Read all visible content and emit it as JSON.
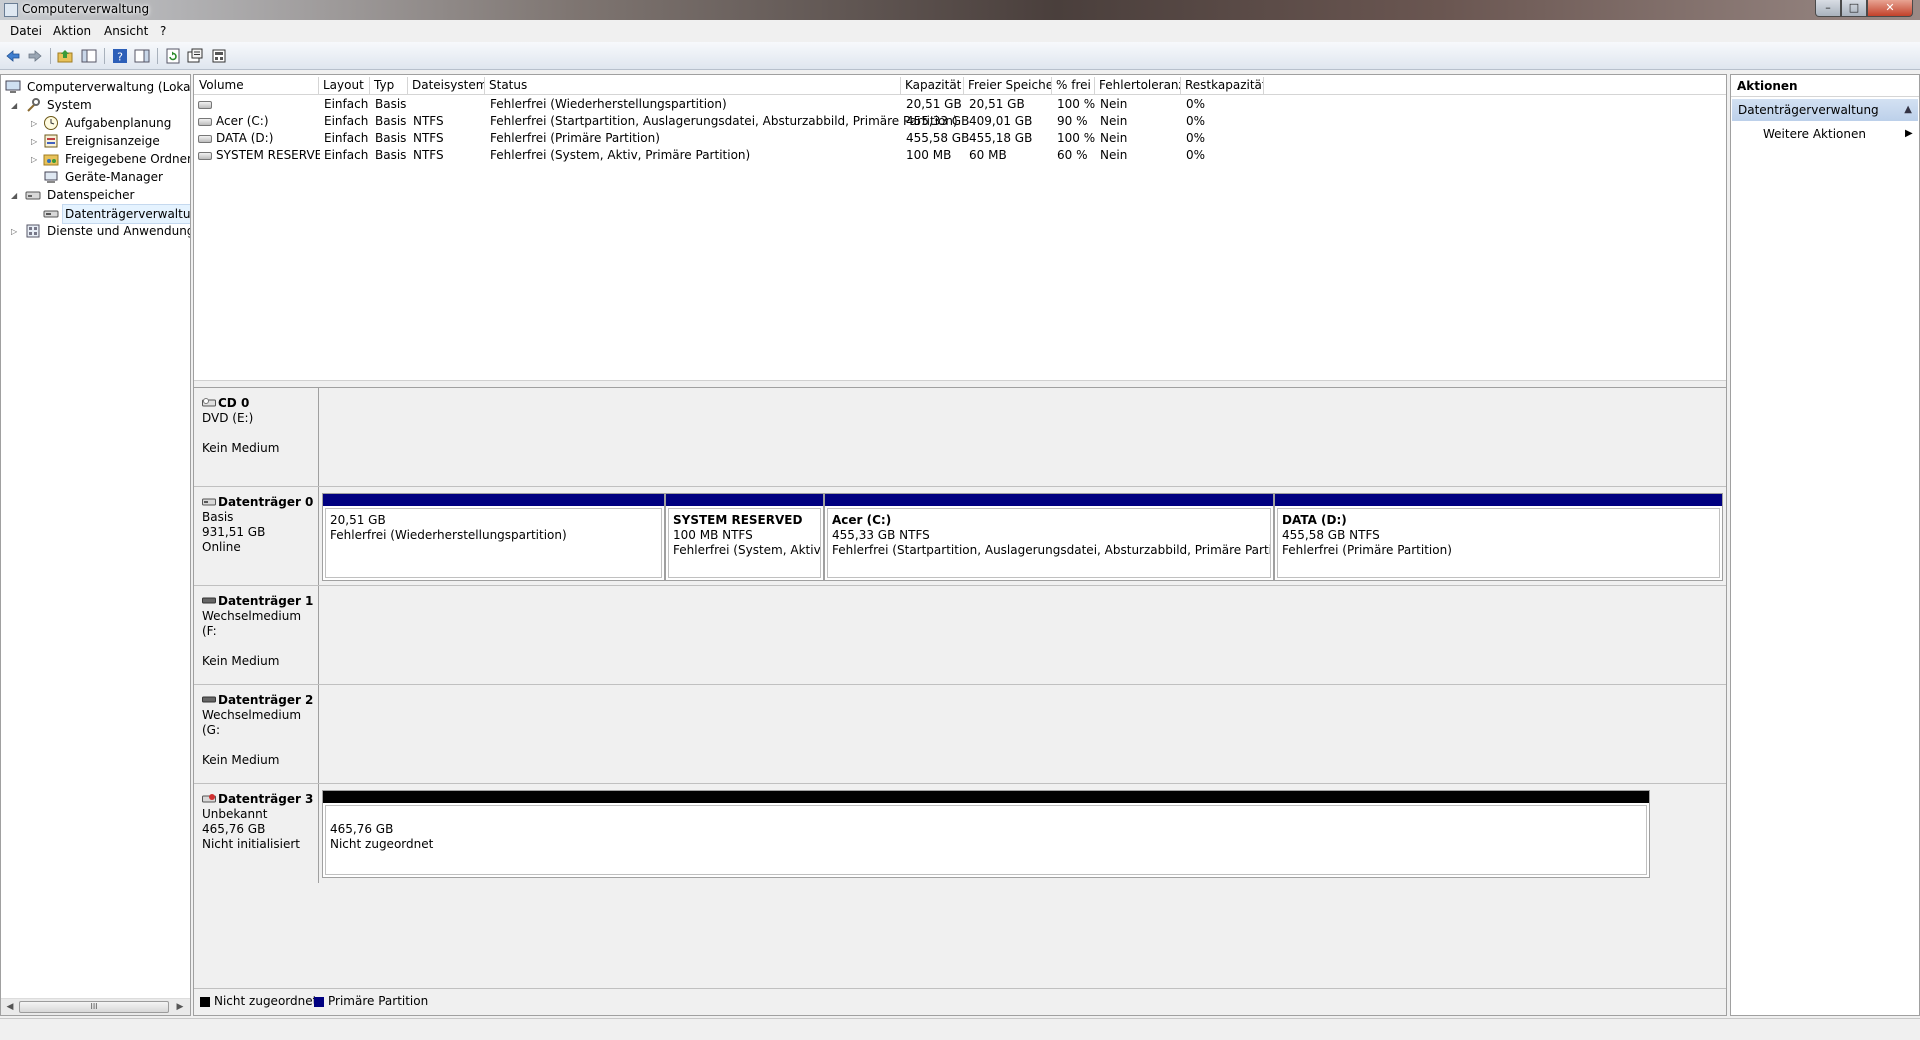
{
  "window": {
    "title": "Computerverwaltung",
    "controls": {
      "minimize": "–",
      "maximize": "□",
      "close": "✕"
    }
  },
  "menu": [
    "Datei",
    "Aktion",
    "Ansicht",
    "?"
  ],
  "toolbar_icons": [
    "back-icon",
    "forward-icon",
    "up-folder-icon",
    "show-hide-tree-icon",
    "help-icon",
    "properties-pane-icon",
    "refresh-icon",
    "properties-icon",
    "snapin-icon"
  ],
  "tree": {
    "root": "Computerverwaltung (Lokal)",
    "system": "System",
    "aufgaben": "Aufgabenplanung",
    "ereignis": "Ereignisanzeige",
    "freigegeben": "Freigegebene Ordner",
    "geraete": "Geräte-Manager",
    "datenspeicher": "Datenspeicher",
    "datentraeger": "Datenträgerverwaltung",
    "dienste": "Dienste und Anwendungen",
    "hscroll_thumb": "III"
  },
  "volume_columns": [
    "Volume",
    "Layout",
    "Typ",
    "Dateisystem",
    "Status",
    "Kapazität",
    "Freier Speicher",
    "% frei",
    "Fehlertoleranz",
    "Restkapazität"
  ],
  "volumes": [
    {
      "volume": "",
      "layout": "Einfach",
      "typ": "Basis",
      "fs": "",
      "status": "Fehlerfrei (Wiederherstellungspartition)",
      "kap": "20,51 GB",
      "frei": "20,51 GB",
      "pct": "100 %",
      "fehler": "Nein",
      "rest": "0%"
    },
    {
      "volume": "Acer (C:)",
      "layout": "Einfach",
      "typ": "Basis",
      "fs": "NTFS",
      "status": "Fehlerfrei (Startpartition, Auslagerungsdatei, Absturzabbild, Primäre Partition)",
      "kap": "455,33 GB",
      "frei": "409,01 GB",
      "pct": "90 %",
      "fehler": "Nein",
      "rest": "0%"
    },
    {
      "volume": "DATA (D:)",
      "layout": "Einfach",
      "typ": "Basis",
      "fs": "NTFS",
      "status": "Fehlerfrei (Primäre Partition)",
      "kap": "455,58 GB",
      "frei": "455,18 GB",
      "pct": "100 %",
      "fehler": "Nein",
      "rest": "0%"
    },
    {
      "volume": "SYSTEM RESERVED",
      "layout": "Einfach",
      "typ": "Basis",
      "fs": "NTFS",
      "status": "Fehlerfrei (System, Aktiv, Primäre Partition)",
      "kap": "100 MB",
      "frei": "60 MB",
      "pct": "60 %",
      "fehler": "Nein",
      "rest": "0%"
    }
  ],
  "disks": {
    "cd0": {
      "name": "CD 0",
      "line1": "DVD (E:)",
      "line2": "",
      "line3": "Kein Medium"
    },
    "disk0": {
      "name": "Datenträger 0",
      "line1": "Basis",
      "line2": "931,51 GB",
      "line3": "Online",
      "partitions": [
        {
          "name": "",
          "line1": "20,51 GB",
          "line2": "Fehlerfrei (Wiederherstellungspartition)"
        },
        {
          "name": "SYSTEM RESERVED",
          "line1": "100 MB NTFS",
          "line2": "Fehlerfrei (System, Aktiv, Pr"
        },
        {
          "name": "Acer  (C:)",
          "line1": "455,33 GB NTFS",
          "line2": "Fehlerfrei (Startpartition, Auslagerungsdatei, Absturzabbild, Primäre Partition)"
        },
        {
          "name": "DATA  (D:)",
          "line1": "455,58 GB NTFS",
          "line2": "Fehlerfrei (Primäre Partition)"
        }
      ]
    },
    "disk1": {
      "name": "Datenträger 1",
      "line1": "Wechselmedium (F:",
      "line2": "",
      "line3": "Kein Medium"
    },
    "disk2": {
      "name": "Datenträger 2",
      "line1": "Wechselmedium (G:",
      "line2": "",
      "line3": "Kein Medium"
    },
    "disk3": {
      "name": "Datenträger 3",
      "line1": "Unbekannt",
      "line2": "465,76 GB",
      "line3": "Nicht initialisiert",
      "partition": {
        "line1": "465,76 GB",
        "line2": "Nicht zugeordnet"
      }
    }
  },
  "legend": [
    {
      "label": "Nicht zugeordnet",
      "color": "#000000"
    },
    {
      "label": "Primäre Partition",
      "color": "#000080"
    }
  ],
  "actions": {
    "header": "Aktionen",
    "section": "Datenträgerverwaltung",
    "more": "Weitere Aktionen"
  }
}
